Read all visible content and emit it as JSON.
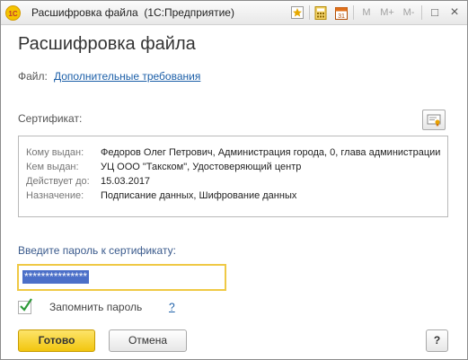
{
  "window": {
    "logo_text": "1С",
    "title": "Расшифровка файла",
    "app": "(1С:Предприятие)",
    "toolbar": {
      "mplus": "M+",
      "mminus": "M-",
      "m": "M",
      "minimize": "□",
      "close": "×"
    }
  },
  "header": {
    "title": "Расшифровка файла"
  },
  "file": {
    "label": "Файл:",
    "link": "Дополнительные требования"
  },
  "certificate": {
    "label": "Сертификат:",
    "rows": [
      {
        "key": "Кому выдан:",
        "value": "Федоров Олег Петрович, Администрация города, 0, глава администрации"
      },
      {
        "key": "Кем выдан:",
        "value": "УЦ ООО \"Такском\", Удостоверяющий центр"
      },
      {
        "key": "Действует до:",
        "value": "15.03.2017"
      },
      {
        "key": "Назначение:",
        "value": "Подписание данных, Шифрование данных"
      }
    ]
  },
  "password": {
    "label": "Введите пароль к сертификату:",
    "value": "***************"
  },
  "remember": {
    "label": "Запомнить пароль",
    "checked": true,
    "help": "?"
  },
  "buttons": {
    "ok": "Готово",
    "cancel": "Отмена",
    "help": "?"
  },
  "colors": {
    "accent": "#f2c60f",
    "link": "#1c5fa8",
    "selection": "#4b6fc8"
  }
}
